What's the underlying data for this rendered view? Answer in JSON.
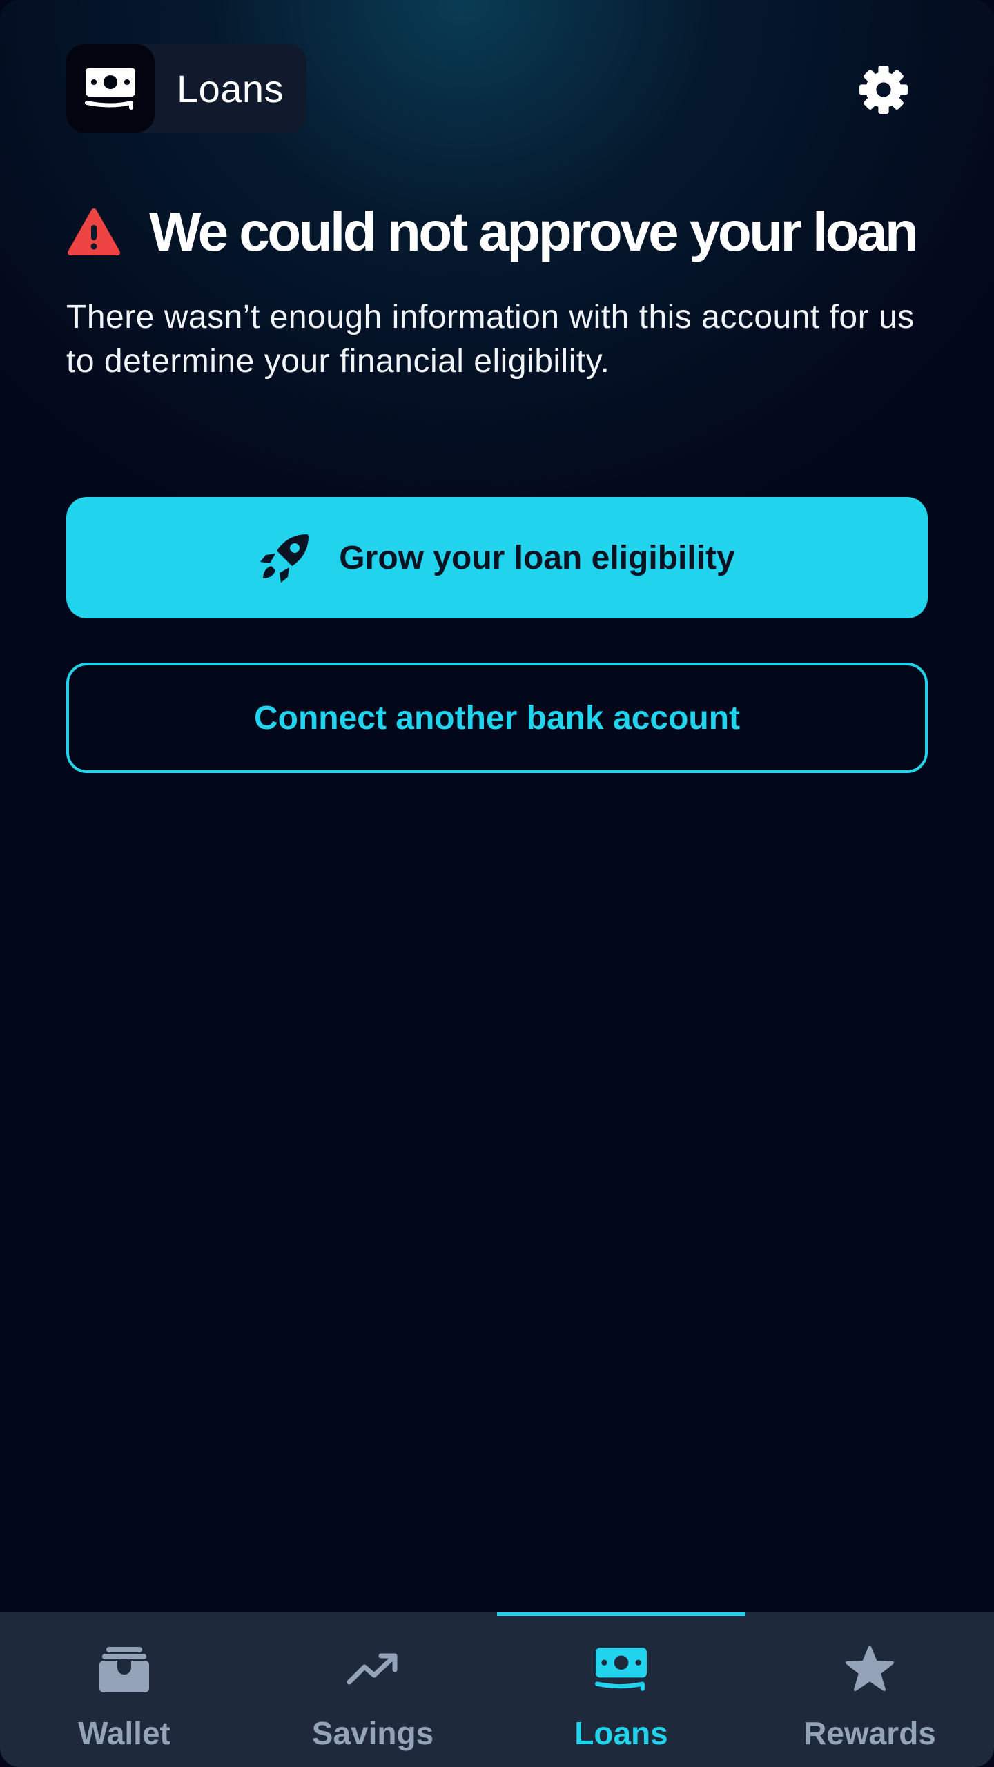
{
  "header": {
    "app_title": "Loans",
    "app_icon": "money-bill-icon",
    "settings_icon": "gear-icon"
  },
  "status": {
    "icon": "warning-triangle-icon",
    "title": "We could not approve your loan",
    "message": "There wasn’t enough information with this account for us to determine your financial eligibility."
  },
  "actions": {
    "primary_label": "Grow your loan eligibility",
    "primary_icon": "rocket-icon",
    "secondary_label": "Connect another bank account"
  },
  "nav": {
    "active_index": 2,
    "items": [
      {
        "label": "Wallet",
        "icon": "wallet-icon"
      },
      {
        "label": "Savings",
        "icon": "trending-up-icon"
      },
      {
        "label": "Loans",
        "icon": "money-bill-icon"
      },
      {
        "label": "Rewards",
        "icon": "star-icon"
      }
    ]
  },
  "colors": {
    "accent": "#22d3ee",
    "warning": "#ef4444",
    "background": "#03071a",
    "nav_background": "#1e293b",
    "nav_inactive": "#94a3b8"
  }
}
